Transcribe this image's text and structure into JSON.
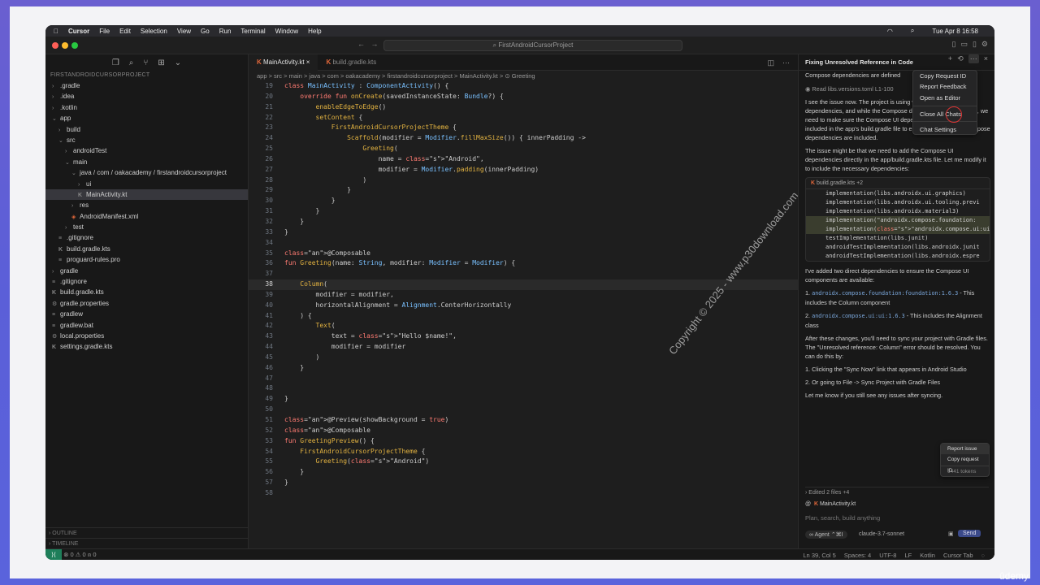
{
  "mac_menubar": {
    "app": "Cursor",
    "items": [
      "File",
      "Edit",
      "Selection",
      "View",
      "Go",
      "Run",
      "Terminal",
      "Window",
      "Help"
    ],
    "datetime": "Tue Apr 8  16:58"
  },
  "titlebar": {
    "search_text": "FirstAndroidCursorProject"
  },
  "sidebar": {
    "project": "FIRSTANDROIDCURSORPROJECT",
    "tree": [
      {
        "label": ".gradle",
        "depth": 0,
        "kind": "folder"
      },
      {
        "label": ".idea",
        "depth": 0,
        "kind": "folder"
      },
      {
        "label": ".kotlin",
        "depth": 0,
        "kind": "folder"
      },
      {
        "label": "app",
        "depth": 0,
        "kind": "open"
      },
      {
        "label": "build",
        "depth": 1,
        "kind": "folder"
      },
      {
        "label": "src",
        "depth": 1,
        "kind": "open"
      },
      {
        "label": "androidTest",
        "depth": 2,
        "kind": "folder"
      },
      {
        "label": "main",
        "depth": 2,
        "kind": "open"
      },
      {
        "label": "java / com / oakacademy / firstandroidcursorproject",
        "depth": 3,
        "kind": "open"
      },
      {
        "label": "ui",
        "depth": 4,
        "kind": "folder"
      },
      {
        "label": "MainActivity.kt",
        "depth": 4,
        "kind": "kt",
        "selected": true
      },
      {
        "label": "res",
        "depth": 3,
        "kind": "folder"
      },
      {
        "label": "AndroidManifest.xml",
        "depth": 3,
        "kind": "xml"
      },
      {
        "label": "test",
        "depth": 2,
        "kind": "folder"
      },
      {
        "label": ".gitignore",
        "depth": 1,
        "kind": "file"
      },
      {
        "label": "build.gradle.kts",
        "depth": 1,
        "kind": "kt"
      },
      {
        "label": "proguard-rules.pro",
        "depth": 1,
        "kind": "file"
      },
      {
        "label": "gradle",
        "depth": 0,
        "kind": "folder"
      },
      {
        "label": ".gitignore",
        "depth": 0,
        "kind": "file"
      },
      {
        "label": "build.gradle.kts",
        "depth": 0,
        "kind": "kt"
      },
      {
        "label": "gradle.properties",
        "depth": 0,
        "kind": "gear"
      },
      {
        "label": "gradlew",
        "depth": 0,
        "kind": "file"
      },
      {
        "label": "gradlew.bat",
        "depth": 0,
        "kind": "file"
      },
      {
        "label": "local.properties",
        "depth": 0,
        "kind": "gear"
      },
      {
        "label": "settings.gradle.kts",
        "depth": 0,
        "kind": "kt"
      }
    ],
    "outline": "OUTLINE",
    "timeline": "TIMELINE"
  },
  "editor": {
    "tabs": [
      {
        "label": "MainActivity.kt",
        "active": true
      },
      {
        "label": "build.gradle.kts",
        "active": false
      }
    ],
    "breadcrumb": "app > src > main > java > com > oakacademy > firstandroidcursorproject > MainActivity.kt > ⊙ Greeting",
    "lines": [
      {
        "n": "19",
        "code": "class MainActivity : ComponentActivity() {"
      },
      {
        "n": "20",
        "code": "    override fun onCreate(savedInstanceState: Bundle?) {"
      },
      {
        "n": "21",
        "code": "        enableEdgeToEdge()"
      },
      {
        "n": "22",
        "code": "        setContent {"
      },
      {
        "n": "23",
        "code": "            FirstAndroidCursorProjectTheme {"
      },
      {
        "n": "24",
        "code": "                Scaffold(modifier = Modifier.fillMaxSize()) { innerPadding ->"
      },
      {
        "n": "25",
        "code": "                    Greeting("
      },
      {
        "n": "26",
        "code": "                        name = \"Android\","
      },
      {
        "n": "27",
        "code": "                        modifier = Modifier.padding(innerPadding)"
      },
      {
        "n": "28",
        "code": "                    )"
      },
      {
        "n": "29",
        "code": "                }"
      },
      {
        "n": "30",
        "code": "            }"
      },
      {
        "n": "31",
        "code": "        }"
      },
      {
        "n": "32",
        "code": "    }"
      },
      {
        "n": "33",
        "code": "}"
      },
      {
        "n": "34",
        "code": ""
      },
      {
        "n": "35",
        "code": "@Composable"
      },
      {
        "n": "36",
        "code": "fun Greeting(name: String, modifier: Modifier = Modifier) {"
      },
      {
        "n": "37",
        "code": ""
      },
      {
        "n": "38",
        "code": "    Column(",
        "current": true
      },
      {
        "n": "39",
        "code": "        modifier = modifier,"
      },
      {
        "n": "40",
        "code": "        horizontalAlignment = Alignment.CenterHorizontally"
      },
      {
        "n": "41",
        "code": "    ) {"
      },
      {
        "n": "42",
        "code": "        Text("
      },
      {
        "n": "43",
        "code": "            text = \"Hello $name!\","
      },
      {
        "n": "44",
        "code": "            modifier = modifier"
      },
      {
        "n": "45",
        "code": "        )"
      },
      {
        "n": "46",
        "code": "    }"
      },
      {
        "n": "47",
        "code": ""
      },
      {
        "n": "48",
        "code": ""
      },
      {
        "n": "49",
        "code": "}"
      },
      {
        "n": "50",
        "code": ""
      },
      {
        "n": "51",
        "code": "@Preview(showBackground = true)"
      },
      {
        "n": "52",
        "code": "@Composable"
      },
      {
        "n": "53",
        "code": "fun GreetingPreview() {"
      },
      {
        "n": "54",
        "code": "    FirstAndroidCursorProjectTheme {"
      },
      {
        "n": "55",
        "code": "        Greeting(\"Android\")"
      },
      {
        "n": "56",
        "code": "    }"
      },
      {
        "n": "57",
        "code": "}"
      },
      {
        "n": "58",
        "code": ""
      }
    ]
  },
  "chat": {
    "title": "Fixing Unresolved Reference in Code",
    "intro": "Compose dependencies are defined",
    "read_file": "Read libs.versions.toml L1-100",
    "para1": "I see the issue now. The project is using version catalog for dependencies, and while the Compose dependencies are defined, we need to make sure the Compose UI dependencies are properly included in the app's build.gradle file to ensure all necessary Compose dependencies are included.",
    "para2": "The issue might be that we need to add the Compose UI dependencies directly in the app/build.gradle.kts file. Let me modify it to include the necessary dependencies:",
    "codebox_file": "build.gradle.kts",
    "codebox_badge": "+2",
    "codebox_lines": [
      {
        "text": "implementation(libs.androidx.ui.graphics)",
        "hl": false
      },
      {
        "text": "implementation(libs.androidx.ui.tooling.previ",
        "hl": false
      },
      {
        "text": "implementation(libs.androidx.material3)",
        "hl": false
      },
      {
        "text": "implementation(\"androidx.compose.foundation:",
        "hl": true
      },
      {
        "text": "implementation(\"androidx.compose.ui:ui:1.6.3\"",
        "hl": true
      },
      {
        "text": "testImplementation(libs.junit)",
        "hl": false
      },
      {
        "text": "androidTestImplementation(libs.androidx.junit",
        "hl": false
      },
      {
        "text": "androidTestImplementation(libs.androidx.espre",
        "hl": false
      }
    ],
    "para3": "I've added two direct dependencies to ensure the Compose UI components are available:",
    "dep1_code": "androidx.compose.foundation:foundation:1.6.3",
    "dep1_text": " - This includes the Column component",
    "dep2_code": "androidx.compose.ui:ui:1.6.3",
    "dep2_text": " - This includes the Alignment class",
    "para4": "After these changes, you'll need to sync your project with Gradle files. The \"Unresolved reference: Column\" error should be resolved. You can do this by:",
    "step1": "Clicking the \"Sync Now\" link that appears in Android Studio",
    "step2": "Or going to File -> Sync Project with Gradle Files",
    "para5": "Let me know if you still see any issues after syncing.",
    "edited": "Edited 2 files +4",
    "context_file": "MainActivity.kt",
    "input_placeholder": "Plan, search, build anything",
    "mode": "Agent",
    "mode_shortcut": "⌃⌘I",
    "model": "claude-3.7-sonnet",
    "send": "Send"
  },
  "top_menu": [
    "Copy Request ID",
    "Report Feedback",
    "Open as Editor",
    "Close All Chats",
    "Chat Settings"
  ],
  "msg_menu": {
    "items": [
      "Report issue",
      "Copy request ID"
    ],
    "tokens": "6441 tokens"
  },
  "statusbar": {
    "left": "⊗ 0 ⚠ 0   ⍝ 0",
    "pos": "Ln 39, Col 5",
    "spaces": "Spaces: 4",
    "enc": "UTF-8",
    "eol": "LF",
    "lang": "Kotlin",
    "tab": "Cursor Tab"
  },
  "watermark": "Copyright © 2025 - www.p30download.com",
  "udemy": "ûdemy"
}
